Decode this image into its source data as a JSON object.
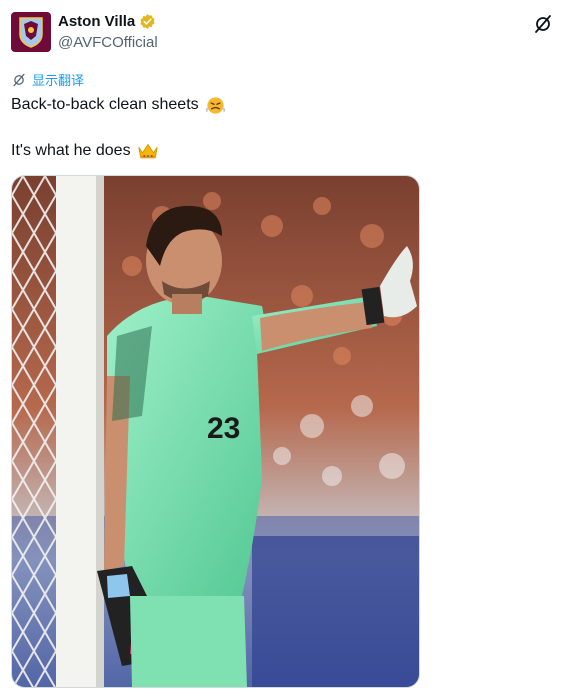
{
  "account": {
    "name": "Aston Villa",
    "handle": "@AVFCOfficial",
    "verified": true,
    "avatar_color": "#6e0b3b",
    "badge_color": "#e2b719"
  },
  "icons": {
    "grok": "grok-icon",
    "translate": "translate-icon",
    "emoji1": "steaming-face-icon",
    "emoji2": "crown-icon"
  },
  "tweet": {
    "translate_label": "显示翻译",
    "line1": "Back-to-back clean sheets",
    "line2": "It's what he does"
  },
  "media": {
    "jersey_number": "23",
    "accent_color": "#7be0b0"
  }
}
